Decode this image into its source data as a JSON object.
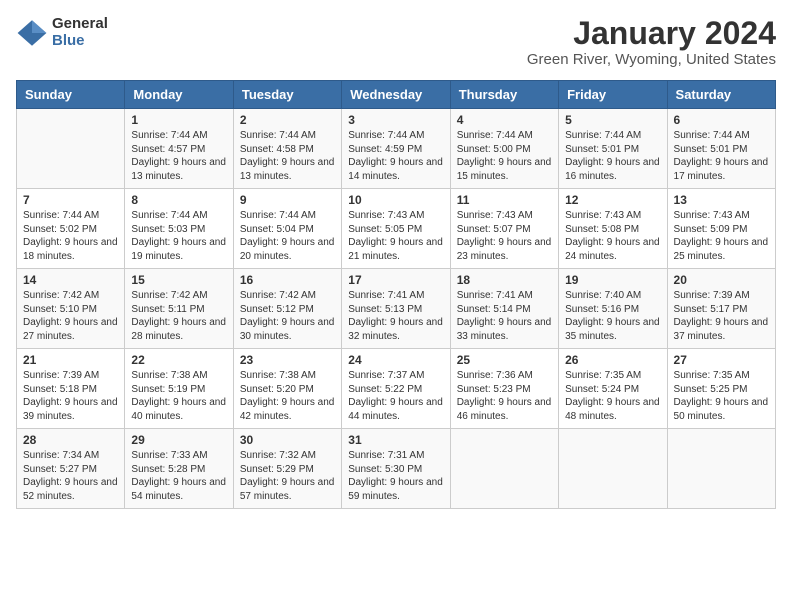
{
  "logo": {
    "general": "General",
    "blue": "Blue"
  },
  "title": "January 2024",
  "location": "Green River, Wyoming, United States",
  "days_header": [
    "Sunday",
    "Monday",
    "Tuesday",
    "Wednesday",
    "Thursday",
    "Friday",
    "Saturday"
  ],
  "weeks": [
    [
      {
        "day": "",
        "sunrise": "",
        "sunset": "",
        "daylight": ""
      },
      {
        "day": "1",
        "sunrise": "Sunrise: 7:44 AM",
        "sunset": "Sunset: 4:57 PM",
        "daylight": "Daylight: 9 hours and 13 minutes."
      },
      {
        "day": "2",
        "sunrise": "Sunrise: 7:44 AM",
        "sunset": "Sunset: 4:58 PM",
        "daylight": "Daylight: 9 hours and 13 minutes."
      },
      {
        "day": "3",
        "sunrise": "Sunrise: 7:44 AM",
        "sunset": "Sunset: 4:59 PM",
        "daylight": "Daylight: 9 hours and 14 minutes."
      },
      {
        "day": "4",
        "sunrise": "Sunrise: 7:44 AM",
        "sunset": "Sunset: 5:00 PM",
        "daylight": "Daylight: 9 hours and 15 minutes."
      },
      {
        "day": "5",
        "sunrise": "Sunrise: 7:44 AM",
        "sunset": "Sunset: 5:01 PM",
        "daylight": "Daylight: 9 hours and 16 minutes."
      },
      {
        "day": "6",
        "sunrise": "Sunrise: 7:44 AM",
        "sunset": "Sunset: 5:01 PM",
        "daylight": "Daylight: 9 hours and 17 minutes."
      }
    ],
    [
      {
        "day": "7",
        "sunrise": "Sunrise: 7:44 AM",
        "sunset": "Sunset: 5:02 PM",
        "daylight": "Daylight: 9 hours and 18 minutes."
      },
      {
        "day": "8",
        "sunrise": "Sunrise: 7:44 AM",
        "sunset": "Sunset: 5:03 PM",
        "daylight": "Daylight: 9 hours and 19 minutes."
      },
      {
        "day": "9",
        "sunrise": "Sunrise: 7:44 AM",
        "sunset": "Sunset: 5:04 PM",
        "daylight": "Daylight: 9 hours and 20 minutes."
      },
      {
        "day": "10",
        "sunrise": "Sunrise: 7:43 AM",
        "sunset": "Sunset: 5:05 PM",
        "daylight": "Daylight: 9 hours and 21 minutes."
      },
      {
        "day": "11",
        "sunrise": "Sunrise: 7:43 AM",
        "sunset": "Sunset: 5:07 PM",
        "daylight": "Daylight: 9 hours and 23 minutes."
      },
      {
        "day": "12",
        "sunrise": "Sunrise: 7:43 AM",
        "sunset": "Sunset: 5:08 PM",
        "daylight": "Daylight: 9 hours and 24 minutes."
      },
      {
        "day": "13",
        "sunrise": "Sunrise: 7:43 AM",
        "sunset": "Sunset: 5:09 PM",
        "daylight": "Daylight: 9 hours and 25 minutes."
      }
    ],
    [
      {
        "day": "14",
        "sunrise": "Sunrise: 7:42 AM",
        "sunset": "Sunset: 5:10 PM",
        "daylight": "Daylight: 9 hours and 27 minutes."
      },
      {
        "day": "15",
        "sunrise": "Sunrise: 7:42 AM",
        "sunset": "Sunset: 5:11 PM",
        "daylight": "Daylight: 9 hours and 28 minutes."
      },
      {
        "day": "16",
        "sunrise": "Sunrise: 7:42 AM",
        "sunset": "Sunset: 5:12 PM",
        "daylight": "Daylight: 9 hours and 30 minutes."
      },
      {
        "day": "17",
        "sunrise": "Sunrise: 7:41 AM",
        "sunset": "Sunset: 5:13 PM",
        "daylight": "Daylight: 9 hours and 32 minutes."
      },
      {
        "day": "18",
        "sunrise": "Sunrise: 7:41 AM",
        "sunset": "Sunset: 5:14 PM",
        "daylight": "Daylight: 9 hours and 33 minutes."
      },
      {
        "day": "19",
        "sunrise": "Sunrise: 7:40 AM",
        "sunset": "Sunset: 5:16 PM",
        "daylight": "Daylight: 9 hours and 35 minutes."
      },
      {
        "day": "20",
        "sunrise": "Sunrise: 7:39 AM",
        "sunset": "Sunset: 5:17 PM",
        "daylight": "Daylight: 9 hours and 37 minutes."
      }
    ],
    [
      {
        "day": "21",
        "sunrise": "Sunrise: 7:39 AM",
        "sunset": "Sunset: 5:18 PM",
        "daylight": "Daylight: 9 hours and 39 minutes."
      },
      {
        "day": "22",
        "sunrise": "Sunrise: 7:38 AM",
        "sunset": "Sunset: 5:19 PM",
        "daylight": "Daylight: 9 hours and 40 minutes."
      },
      {
        "day": "23",
        "sunrise": "Sunrise: 7:38 AM",
        "sunset": "Sunset: 5:20 PM",
        "daylight": "Daylight: 9 hours and 42 minutes."
      },
      {
        "day": "24",
        "sunrise": "Sunrise: 7:37 AM",
        "sunset": "Sunset: 5:22 PM",
        "daylight": "Daylight: 9 hours and 44 minutes."
      },
      {
        "day": "25",
        "sunrise": "Sunrise: 7:36 AM",
        "sunset": "Sunset: 5:23 PM",
        "daylight": "Daylight: 9 hours and 46 minutes."
      },
      {
        "day": "26",
        "sunrise": "Sunrise: 7:35 AM",
        "sunset": "Sunset: 5:24 PM",
        "daylight": "Daylight: 9 hours and 48 minutes."
      },
      {
        "day": "27",
        "sunrise": "Sunrise: 7:35 AM",
        "sunset": "Sunset: 5:25 PM",
        "daylight": "Daylight: 9 hours and 50 minutes."
      }
    ],
    [
      {
        "day": "28",
        "sunrise": "Sunrise: 7:34 AM",
        "sunset": "Sunset: 5:27 PM",
        "daylight": "Daylight: 9 hours and 52 minutes."
      },
      {
        "day": "29",
        "sunrise": "Sunrise: 7:33 AM",
        "sunset": "Sunset: 5:28 PM",
        "daylight": "Daylight: 9 hours and 54 minutes."
      },
      {
        "day": "30",
        "sunrise": "Sunrise: 7:32 AM",
        "sunset": "Sunset: 5:29 PM",
        "daylight": "Daylight: 9 hours and 57 minutes."
      },
      {
        "day": "31",
        "sunrise": "Sunrise: 7:31 AM",
        "sunset": "Sunset: 5:30 PM",
        "daylight": "Daylight: 9 hours and 59 minutes."
      },
      {
        "day": "",
        "sunrise": "",
        "sunset": "",
        "daylight": ""
      },
      {
        "day": "",
        "sunrise": "",
        "sunset": "",
        "daylight": ""
      },
      {
        "day": "",
        "sunrise": "",
        "sunset": "",
        "daylight": ""
      }
    ]
  ]
}
